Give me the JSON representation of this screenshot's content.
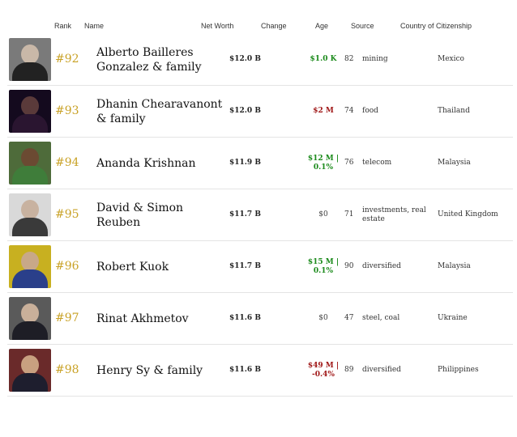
{
  "columns": {
    "rank": "Rank",
    "name": "Name",
    "net_worth": "Net Worth",
    "change": "Change",
    "age": "Age",
    "source": "Source",
    "country": "Country of Citizenship"
  },
  "colors": {
    "rank": "#c9a227",
    "change_up": "#1a8a1a",
    "change_down": "#a01818"
  },
  "rows": [
    {
      "rank": "#92",
      "name": "Alberto Bailleres Gonzalez & family",
      "net_worth": "$12.0 B",
      "change": "$1.0 K",
      "change_dir": "up",
      "age": "82",
      "source": "mining",
      "country": "Mexico",
      "photo": {
        "bg": "#7a7a7a",
        "skin": "#c9b8a8",
        "suit": "#222222"
      }
    },
    {
      "rank": "#93",
      "name": "Dhanin Chearavanont & family",
      "net_worth": "$12.0 B",
      "change": "$2 M",
      "change_dir": "down",
      "age": "74",
      "source": "food",
      "country": "Thailand",
      "photo": {
        "bg": "#140a1e",
        "skin": "#5a3a3a",
        "suit": "#2a1530"
      }
    },
    {
      "rank": "#94",
      "name": "Ananda Krishnan",
      "net_worth": "$11.9 B",
      "change": "$12 M | 0.1%",
      "change_dir": "up",
      "age": "76",
      "source": "telecom",
      "country": "Malaysia",
      "photo": {
        "bg": "#4e6b3a",
        "skin": "#6b4a32",
        "suit": "#3f7d3a"
      }
    },
    {
      "rank": "#95",
      "name": "David & Simon Reuben",
      "net_worth": "$11.7 B",
      "change": "$0",
      "change_dir": "flat",
      "age": "71",
      "source": "investments, real estate",
      "country": "United Kingdom",
      "photo": {
        "bg": "#d9d9d9",
        "skin": "#c8b2a0",
        "suit": "#3a3a3a"
      }
    },
    {
      "rank": "#96",
      "name": "Robert Kuok",
      "net_worth": "$11.7 B",
      "change": "$15 M | 0.1%",
      "change_dir": "up",
      "age": "90",
      "source": "diversified",
      "country": "Malaysia",
      "photo": {
        "bg": "#c8b020",
        "skin": "#c8a888",
        "suit": "#2a3f8a"
      }
    },
    {
      "rank": "#97",
      "name": "Rinat Akhmetov",
      "net_worth": "$11.6 B",
      "change": "$0",
      "change_dir": "flat",
      "age": "47",
      "source": "steel, coal",
      "country": "Ukraine",
      "photo": {
        "bg": "#5a5a5a",
        "skin": "#c9b09a",
        "suit": "#1e1e26"
      }
    },
    {
      "rank": "#98",
      "name": "Henry Sy & family",
      "net_worth": "$11.6 B",
      "change": "$49 M | -0.4%",
      "change_dir": "down",
      "age": "89",
      "source": "diversified",
      "country": "Philippines",
      "photo": {
        "bg": "#6a2a2a",
        "skin": "#c8a080",
        "suit": "#1e1e2e"
      }
    }
  ]
}
